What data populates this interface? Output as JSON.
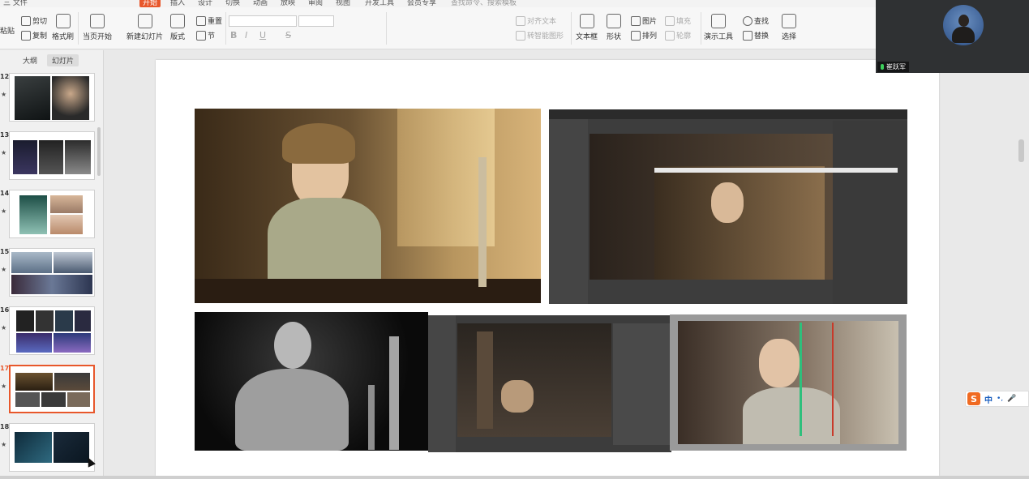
{
  "menubar": {
    "items": [
      "三 文件",
      "开始",
      "插入",
      "设计",
      "切换",
      "动画",
      "放映",
      "审阅",
      "视图",
      "开发工具",
      "会员专享"
    ],
    "active": "开始",
    "search": "查找命令、搜索模板"
  },
  "ribbon": {
    "paste": "粘贴",
    "cut": "剪切",
    "copy": "复制",
    "format_painter": "格式刷",
    "from_current": "当页开始",
    "new_slide": "新建幻灯片",
    "layout": "版式",
    "reset": "重置",
    "section": "节",
    "text_direction": "对齐文本",
    "convert_smartart": "转智能图形",
    "textbox": "文本框",
    "shape": "形状",
    "picture": "图片",
    "arrange": "排列",
    "fill": "填充",
    "outline": "轮廓",
    "presentation_tools": "演示工具",
    "find": "查找",
    "replace": "替换",
    "select": "选择"
  },
  "left_panel": {
    "tabs": [
      "大纲",
      "幻灯片"
    ],
    "active_tab": "幻灯片",
    "slides": [
      {
        "num": "12",
        "current": false
      },
      {
        "num": "13",
        "current": false
      },
      {
        "num": "14",
        "current": false
      },
      {
        "num": "15",
        "current": false
      },
      {
        "num": "16",
        "current": false
      },
      {
        "num": "17",
        "current": true
      },
      {
        "num": "18",
        "current": false
      }
    ],
    "star": "★"
  },
  "video": {
    "name": "崔跃军"
  },
  "ime": {
    "logo": "S",
    "lang": "中",
    "punct": "•,",
    "mic": "🎤"
  },
  "colors": {
    "accent": "#e8572b",
    "ime_blue": "#1b5fbf"
  }
}
